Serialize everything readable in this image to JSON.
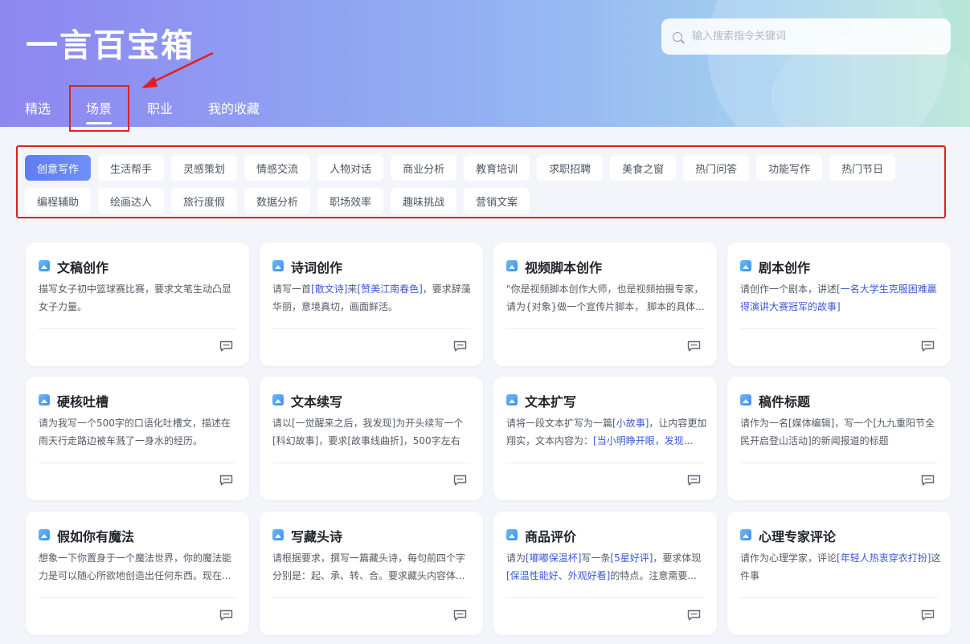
{
  "app": {
    "title": "一言百宝箱"
  },
  "search": {
    "placeholder": "输入搜索指令关键词"
  },
  "tabs": [
    {
      "label": "精选"
    },
    {
      "label": "场景",
      "active": true
    },
    {
      "label": "职业"
    },
    {
      "label": "我的收藏"
    }
  ],
  "categories": [
    {
      "label": "创意写作",
      "active": true
    },
    {
      "label": "生活帮手"
    },
    {
      "label": "灵感策划"
    },
    {
      "label": "情感交流"
    },
    {
      "label": "人物对话"
    },
    {
      "label": "商业分析"
    },
    {
      "label": "教育培训"
    },
    {
      "label": "求职招聘"
    },
    {
      "label": "美食之窗"
    },
    {
      "label": "热门问答"
    },
    {
      "label": "功能写作"
    },
    {
      "label": "热门节日"
    },
    {
      "label": "编程辅助"
    },
    {
      "label": "绘画达人"
    },
    {
      "label": "旅行度假"
    },
    {
      "label": "数据分析"
    },
    {
      "label": "职场效率"
    },
    {
      "label": "趣味挑战"
    },
    {
      "label": "营销文案"
    }
  ],
  "cards": [
    {
      "title": "文稿创作",
      "segments": [
        {
          "t": "描写女子初中篮球赛比赛，要求文笔生动凸显女子力量。"
        }
      ]
    },
    {
      "title": "诗词创作",
      "segments": [
        {
          "t": "请写一首"
        },
        {
          "t": "[散文诗]",
          "hl": true
        },
        {
          "t": "来"
        },
        {
          "t": "[赞美江南春色]",
          "hl": true
        },
        {
          "t": "，要求辞藻华丽，意境真切，画面鲜活。"
        }
      ]
    },
    {
      "title": "视频脚本创作",
      "segments": [
        {
          "t": "\"你是视频脚本创作大师，也是视频拍摄专家，请为{对象}做一个宣传片脚本， 脚本的具体..."
        }
      ]
    },
    {
      "title": "剧本创作",
      "segments": [
        {
          "t": "请创作一个剧本，讲述"
        },
        {
          "t": "[一名大学生克服困难赢得演讲大赛冠军的故事]",
          "hl": true
        }
      ]
    },
    {
      "title": "硬核吐槽",
      "segments": [
        {
          "t": "请为我写一个500字的口语化吐槽文，描述在雨天行走路边被车溅了一身水的经历。"
        }
      ]
    },
    {
      "title": "文本续写",
      "segments": [
        {
          "t": "请以[一觉醒来之后，我发现]为开头续写一个[科幻故事]，要求[故事线曲折]，500字左右"
        }
      ]
    },
    {
      "title": "文本扩写",
      "segments": [
        {
          "t": "请将一段文本扩写为一篇"
        },
        {
          "t": "[小故事]",
          "hl": true
        },
        {
          "t": "，让内容更加翔实，文本内容为："
        },
        {
          "t": "[当小明睁开眼，发现...",
          "hl": true
        }
      ]
    },
    {
      "title": "稿件标题",
      "segments": [
        {
          "t": "请作为一名[媒体编辑]，写一个[九九重阳节全民开启登山活动]的新闻报道的标题"
        }
      ]
    },
    {
      "title": "假如你有魔法",
      "segments": [
        {
          "t": "想象一下你置身于一个魔法世界，你的魔法能力是可以随心所欲地创造出任何东西。现在..."
        }
      ]
    },
    {
      "title": "写藏头诗",
      "segments": [
        {
          "t": "请根据要求，撰写一篇藏头诗，每句前四个字分别是：起、承、转、合。要求藏头内容体..."
        }
      ]
    },
    {
      "title": "商品评价",
      "segments": [
        {
          "t": "请为"
        },
        {
          "t": "[嘟嘟保温杯]",
          "hl": true
        },
        {
          "t": "写一条"
        },
        {
          "t": "[5星好评]",
          "hl": true
        },
        {
          "t": "，要求体现"
        },
        {
          "t": "[保温性能好、外观好看]",
          "hl": true
        },
        {
          "t": "的特点。注意需要..."
        }
      ]
    },
    {
      "title": "心理专家评论",
      "segments": [
        {
          "t": "请作为心理学家，评论"
        },
        {
          "t": "[年轻人热衷穿衣打扮]",
          "hl": true
        },
        {
          "t": "这件事"
        }
      ]
    }
  ],
  "colors": {
    "accent": "#5f7cf5",
    "highlight": "#3b59d6",
    "annotation": "#e02020"
  },
  "icons": {
    "search": "search-icon",
    "chat": "chat-bubble-icon",
    "card": "image-thumb-icon"
  }
}
